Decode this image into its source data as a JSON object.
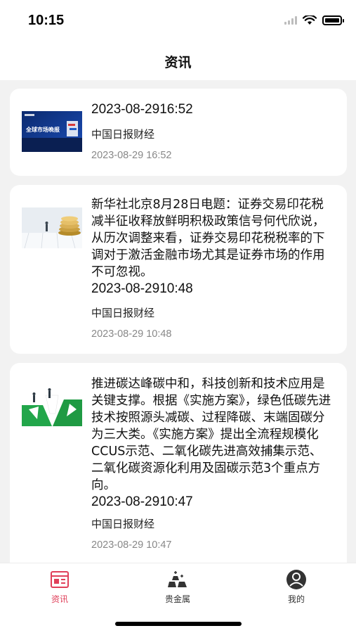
{
  "status_bar": {
    "time": "10:15"
  },
  "nav": {
    "title": "资讯"
  },
  "news": [
    {
      "headline": "2023-08-2916:52",
      "source": "中国日报财经",
      "date": "2023-08-29 16:52",
      "thumb_icon": "global-market-banner-thumbnail"
    },
    {
      "headline": "新华社北京8月28日电题：证券交易印花税减半征收释放鲜明积极政策信号何代欣说，从历次调整来看，证券交易印花税税率的下调对于激活金融市场尤其是证券市场的作用不可忽视。",
      "headline_time": "2023-08-2910:48",
      "source": "中国日报财经",
      "date": "2023-08-29 10:48",
      "thumb_icon": "coins-businessman-thumbnail"
    },
    {
      "headline": "推进碳达峰碳中和，科技创新和技术应用是关键支撑。根据《实施方案》，绿色低碳先进技术按照源头减碳、过程降碳、末端固碳分为三大类。《实施方案》提出全流程规模化CCUS示范、二氧化碳先进高效捕集示范、二氧化碳资源化利用及固碳示范3个重点方向。",
      "headline_time": "2023-08-2910:47",
      "source": "中国日报财经",
      "date": "2023-08-29 10:47",
      "thumb_icon": "green-arrows-thumbnail"
    }
  ],
  "thumb1_text": "全球市场晚报",
  "tabs": [
    {
      "label": "资讯",
      "icon": "news-icon",
      "active": true
    },
    {
      "label": "贵金属",
      "icon": "gold-bars-icon",
      "active": false
    },
    {
      "label": "我的",
      "icon": "profile-icon",
      "active": false
    }
  ],
  "colors": {
    "accent": "#e0405a",
    "background": "#f2f2f2",
    "card": "#ffffff",
    "muted": "#888888"
  }
}
